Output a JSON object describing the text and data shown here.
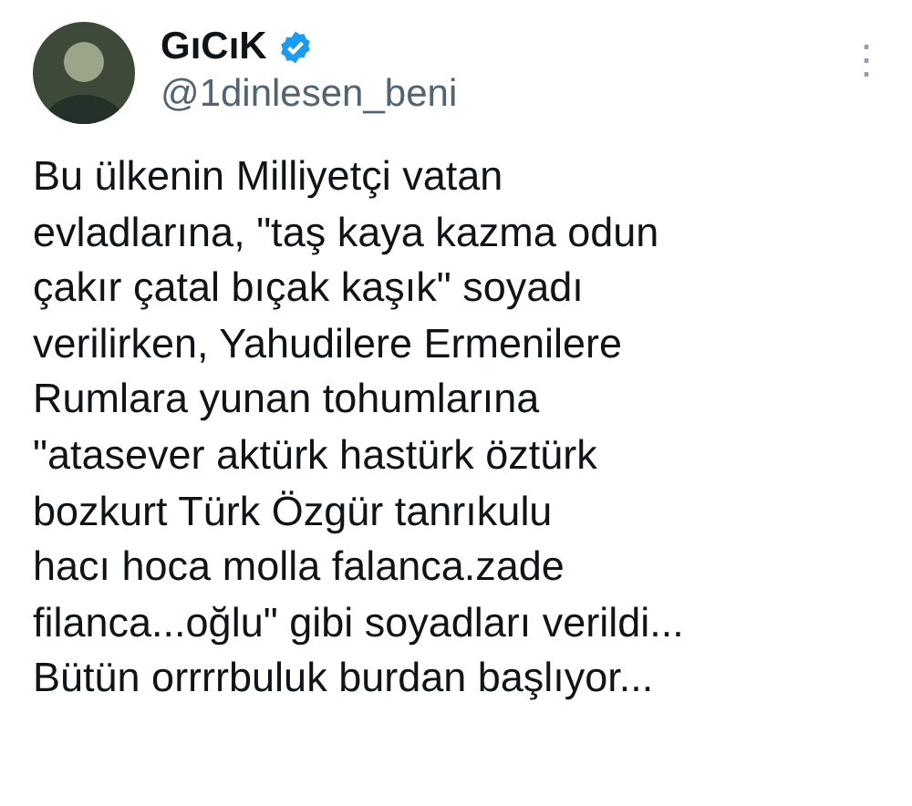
{
  "author": {
    "name": "GıCıK",
    "verified": true,
    "handle": "@1dinlesen_beni"
  },
  "menu": "⋮",
  "body_lines": [
    "Bu ülkenin Milliyetçi vatan",
    "evladlarına, \"taş kaya kazma odun",
    "çakır çatal bıçak kaşık\" soyadı",
    "verilirken, Yahudilere Ermenilere",
    "Rumlara yunan tohumlarına",
    "\"atasever aktürk hastürk öztürk",
    "bozkurt Türk Özgür tanrıkulu",
    "hacı hoca molla falanca.zade",
    "filanca...oğlu\" gibi soyadları verildi...",
    "Bütün orrrrbuluk burdan başlıyor..."
  ]
}
